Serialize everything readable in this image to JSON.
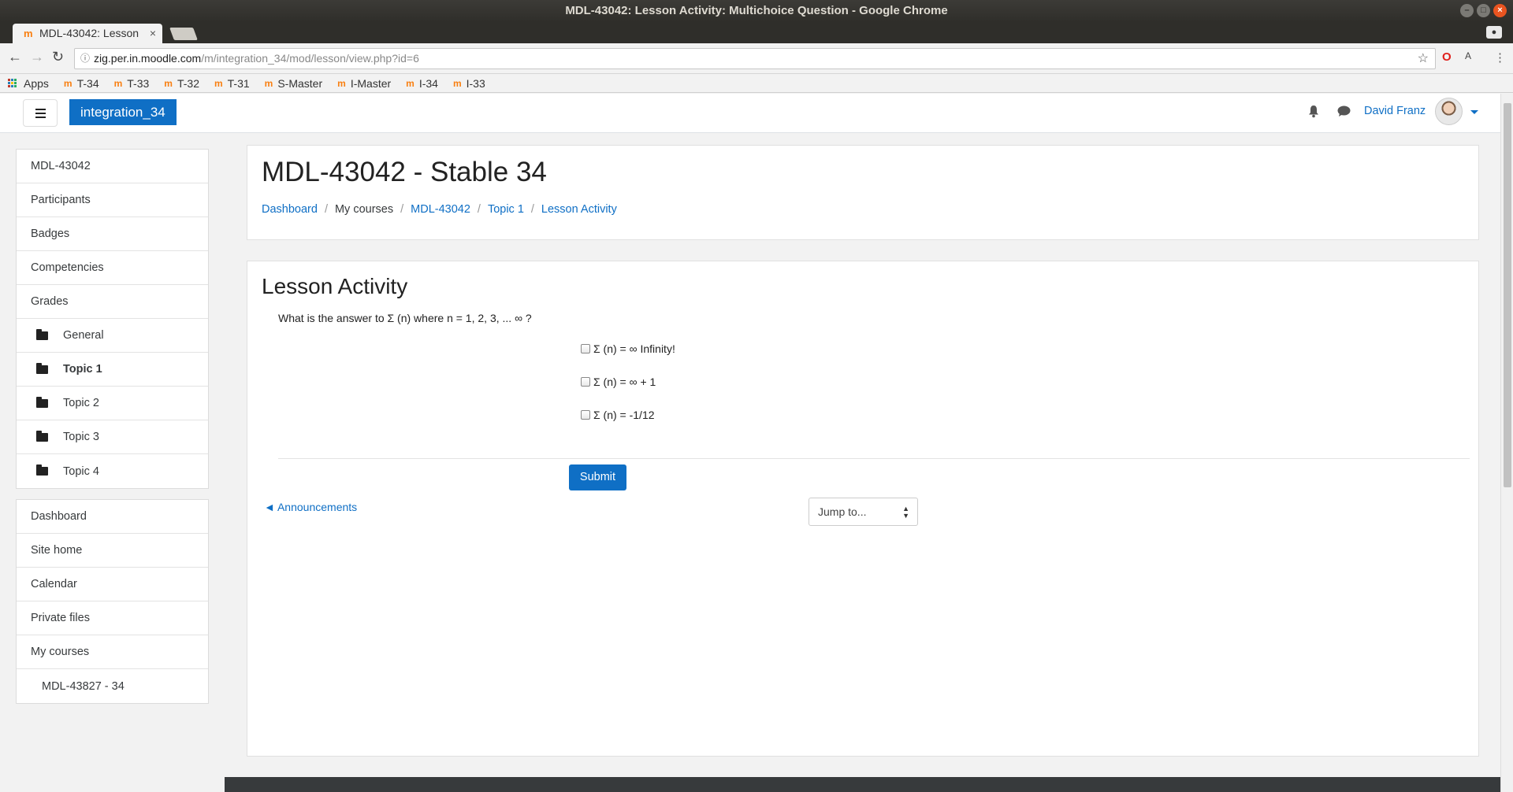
{
  "window": {
    "title": "MDL-43042: Lesson Activity: Multichoice Question - Google Chrome"
  },
  "tab": {
    "title": "MDL-43042: Lesson",
    "favicon": "m",
    "close": "×"
  },
  "address": {
    "host": "zig.per.in.moodle.com",
    "path": "/m/integration_34/mod/lesson/view.php?id=6"
  },
  "bookmarks": {
    "apps_label": "Apps",
    "items": [
      {
        "label": "T-34"
      },
      {
        "label": "T-33"
      },
      {
        "label": "T-32"
      },
      {
        "label": "T-31"
      },
      {
        "label": "S-Master"
      },
      {
        "label": "I-Master"
      },
      {
        "label": "I-34"
      },
      {
        "label": "I-33"
      }
    ]
  },
  "navbar": {
    "site_name": "integration_34",
    "user_name": "David Franz"
  },
  "drawer": {
    "course_items": [
      {
        "label": "MDL-43042",
        "type": "link"
      },
      {
        "label": "Participants",
        "type": "link"
      },
      {
        "label": "Badges",
        "type": "link"
      },
      {
        "label": "Competencies",
        "type": "link"
      },
      {
        "label": "Grades",
        "type": "link"
      },
      {
        "label": "General",
        "type": "section"
      },
      {
        "label": "Topic 1",
        "type": "section",
        "active": true
      },
      {
        "label": "Topic 2",
        "type": "section"
      },
      {
        "label": "Topic 3",
        "type": "section"
      },
      {
        "label": "Topic 4",
        "type": "section"
      }
    ],
    "site_items": [
      {
        "label": "Dashboard"
      },
      {
        "label": "Site home"
      },
      {
        "label": "Calendar"
      },
      {
        "label": "Private files"
      },
      {
        "label": "My courses"
      },
      {
        "label": "MDL-43827 - 34",
        "type": "course"
      }
    ]
  },
  "header": {
    "course_title": "MDL-43042 - Stable 34",
    "breadcrumb": [
      {
        "label": "Dashboard",
        "link": true
      },
      {
        "label": "My courses",
        "link": false
      },
      {
        "label": "MDL-43042",
        "link": true
      },
      {
        "label": "Topic 1",
        "link": true
      },
      {
        "label": "Lesson Activity",
        "link": true
      }
    ]
  },
  "lesson": {
    "title": "Lesson Activity",
    "question": "What is the answer to Σ (n) where n = 1, 2, 3, ... ∞ ?",
    "answers": [
      {
        "label": "Σ (n) = ∞ Infinity!",
        "checked": false
      },
      {
        "label": "Σ (n) = ∞ + 1",
        "checked": false
      },
      {
        "label": "Σ (n) = -1/12",
        "checked": false
      }
    ],
    "submit_label": "Submit",
    "prev_activity": "◄ Announcements",
    "jump_placeholder": "Jump to..."
  },
  "colors": {
    "brand": "#0f6fc5",
    "moodle_orange": "#f98012"
  }
}
